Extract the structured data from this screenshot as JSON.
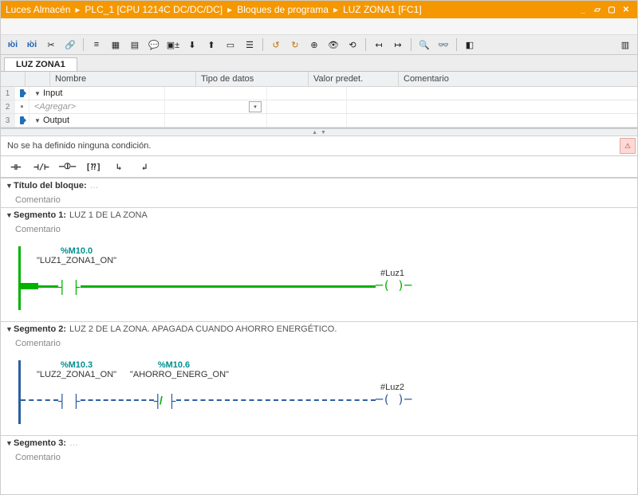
{
  "breadcrumb": [
    "Luces Almacén",
    "PLC_1 [CPU 1214C DC/DC/DC]",
    "Bloques de programa",
    "LUZ ZONA1 [FC1]"
  ],
  "tab": "LUZ ZONA1",
  "intf": {
    "headers": {
      "name": "Nombre",
      "type": "Tipo de datos",
      "def": "Valor predet.",
      "com": "Comentario"
    },
    "rows": [
      {
        "idx": "1",
        "kind": "io",
        "name": "Input"
      },
      {
        "idx": "2",
        "kind": "add",
        "name": "<Agregar>"
      },
      {
        "idx": "3",
        "kind": "io",
        "name": "Output"
      }
    ]
  },
  "cond": "No se ha definido ninguna condición.",
  "block_title_label": "Título del bloque:",
  "comment_label": "Comentario",
  "segments": [
    {
      "title_prefix": "Segmento 1:",
      "title": "LUZ 1 DE LA ZONA",
      "powered": true,
      "contacts": [
        {
          "addr": "%M10.0",
          "sym": "\"LUZ1_ZONA1_ON\"",
          "nc": false
        }
      ],
      "output": "#Luz1"
    },
    {
      "title_prefix": "Segmento 2:",
      "title": "LUZ 2 DE LA ZONA. APAGADA CUANDO AHORRO ENERGÉTICO.",
      "powered": false,
      "contacts": [
        {
          "addr": "%M10.3",
          "sym": "\"LUZ2_ZONA1_ON\"",
          "nc": false
        },
        {
          "addr": "%M10.6",
          "sym": "\"AHORRO_ENERG_ON\"",
          "nc": true
        }
      ],
      "output": "#Luz2"
    },
    {
      "title_prefix": "Segmento 3:",
      "title": "",
      "empty": true
    }
  ],
  "chart_data": {
    "type": "ladder-diagram",
    "title": "LUZ ZONA1 [FC1]",
    "networks": [
      {
        "name": "Segmento 1",
        "comment": "LUZ 1 DE LA ZONA",
        "rung": [
          {
            "type": "NO",
            "operand": "%M10.0",
            "symbol": "LUZ1_ZONA1_ON"
          },
          {
            "type": "coil",
            "operand": "#Luz1"
          }
        ],
        "power_flow": true
      },
      {
        "name": "Segmento 2",
        "comment": "LUZ 2 DE LA ZONA. APAGADA CUANDO AHORRO ENERGÉTICO.",
        "rung": [
          {
            "type": "NO",
            "operand": "%M10.3",
            "symbol": "LUZ2_ZONA1_ON"
          },
          {
            "type": "NC",
            "operand": "%M10.6",
            "symbol": "AHORRO_ENERG_ON"
          },
          {
            "type": "coil",
            "operand": "#Luz2"
          }
        ],
        "power_flow": false
      },
      {
        "name": "Segmento 3",
        "rung": []
      }
    ]
  }
}
